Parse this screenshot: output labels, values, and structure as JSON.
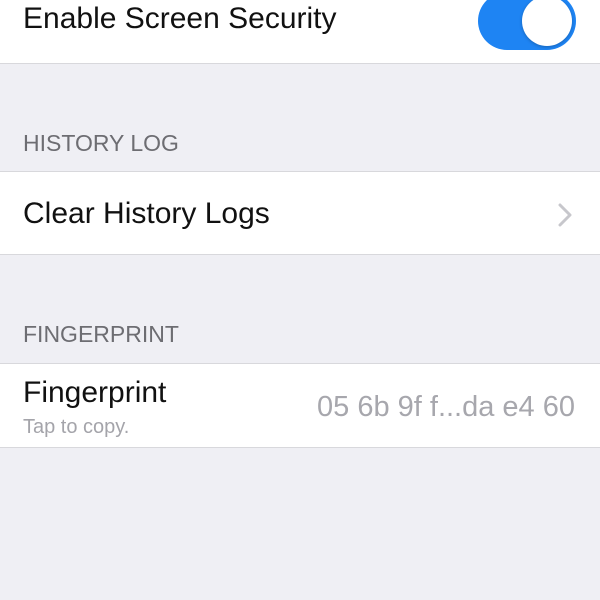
{
  "settings": {
    "screen_security": {
      "label": "Enable Screen Security",
      "enabled": true
    },
    "history": {
      "section_title": "HISTORY LOG",
      "clear_label": "Clear History Logs"
    },
    "fingerprint": {
      "section_title": "FINGERPRINT",
      "label": "Fingerprint",
      "subtitle": "Tap to copy.",
      "value": "05 6b 9f f...da e4 60"
    }
  },
  "colors": {
    "background": "#efeff4",
    "cell_background": "#ffffff",
    "toggle_on": "#1e84f3",
    "primary_text": "#111111",
    "secondary_text": "#6d6d72",
    "detail_text": "#a7a7ad"
  },
  "icons": {
    "disclosure": "chevron-right-icon"
  }
}
